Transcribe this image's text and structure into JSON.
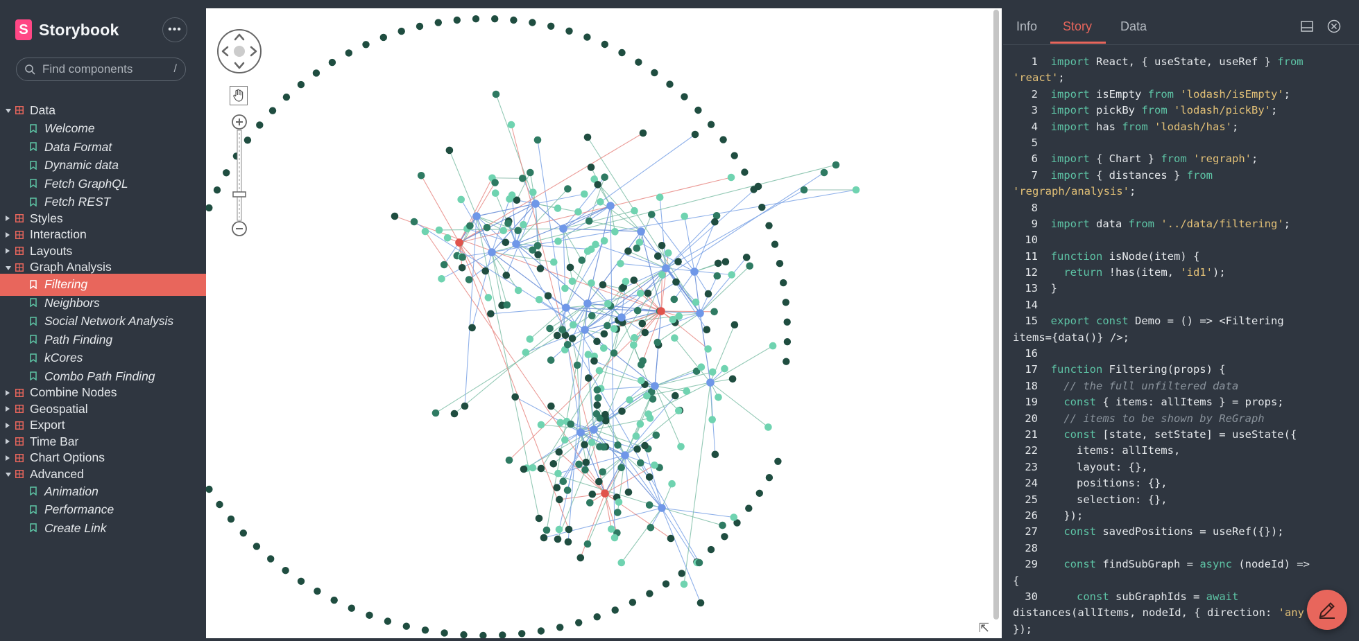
{
  "sidebar": {
    "brand_name": "Storybook",
    "menu_label": "•••",
    "search_placeholder": "Find components",
    "search_shortcut": "/",
    "tree": [
      {
        "type": "group",
        "label": "Data",
        "open": true
      },
      {
        "type": "story",
        "label": "Welcome"
      },
      {
        "type": "story",
        "label": "Data Format"
      },
      {
        "type": "story",
        "label": "Dynamic data"
      },
      {
        "type": "story",
        "label": "Fetch GraphQL"
      },
      {
        "type": "story",
        "label": "Fetch REST"
      },
      {
        "type": "group",
        "label": "Styles",
        "open": false
      },
      {
        "type": "group",
        "label": "Interaction",
        "open": false
      },
      {
        "type": "group",
        "label": "Layouts",
        "open": false
      },
      {
        "type": "group",
        "label": "Graph Analysis",
        "open": true
      },
      {
        "type": "story",
        "label": "Filtering",
        "active": true
      },
      {
        "type": "story",
        "label": "Neighbors"
      },
      {
        "type": "story",
        "label": "Social Network Analysis"
      },
      {
        "type": "story",
        "label": "Path Finding"
      },
      {
        "type": "story",
        "label": "kCores"
      },
      {
        "type": "story",
        "label": "Combo Path Finding"
      },
      {
        "type": "group",
        "label": "Combine Nodes",
        "open": false
      },
      {
        "type": "group",
        "label": "Geospatial",
        "open": false
      },
      {
        "type": "group",
        "label": "Export",
        "open": false
      },
      {
        "type": "group",
        "label": "Time Bar",
        "open": false
      },
      {
        "type": "group",
        "label": "Chart Options",
        "open": false
      },
      {
        "type": "group",
        "label": "Advanced",
        "open": true
      },
      {
        "type": "story",
        "label": "Animation"
      },
      {
        "type": "story",
        "label": "Performance"
      },
      {
        "type": "story",
        "label": "Create Link"
      }
    ]
  },
  "panel": {
    "tabs": [
      {
        "label": "Info",
        "active": false
      },
      {
        "label": "Story",
        "active": true
      },
      {
        "label": "Data",
        "active": false
      }
    ],
    "code_lines": [
      {
        "n": "1",
        "t": "import React, { useState, useRef } from"
      },
      {
        "n": "",
        "t": "'react';"
      },
      {
        "n": "2",
        "t": "import isEmpty from 'lodash/isEmpty';"
      },
      {
        "n": "3",
        "t": "import pickBy from 'lodash/pickBy';"
      },
      {
        "n": "4",
        "t": "import has from 'lodash/has';"
      },
      {
        "n": "5",
        "t": ""
      },
      {
        "n": "6",
        "t": "import { Chart } from 'regraph';"
      },
      {
        "n": "7",
        "t": "import { distances } from"
      },
      {
        "n": "",
        "t": "'regraph/analysis';"
      },
      {
        "n": "8",
        "t": ""
      },
      {
        "n": "9",
        "t": "import data from '../data/filtering';"
      },
      {
        "n": "10",
        "t": ""
      },
      {
        "n": "11",
        "t": "function isNode(item) {"
      },
      {
        "n": "12",
        "t": "  return !has(item, 'id1');"
      },
      {
        "n": "13",
        "t": "}"
      },
      {
        "n": "14",
        "t": ""
      },
      {
        "n": "15",
        "t": "export const Demo = () => <Filtering"
      },
      {
        "n": "",
        "t": "items={data()} />;"
      },
      {
        "n": "16",
        "t": ""
      },
      {
        "n": "17",
        "t": "function Filtering(props) {"
      },
      {
        "n": "18",
        "t": "  // the full unfiltered data"
      },
      {
        "n": "19",
        "t": "  const { items: allItems } = props;"
      },
      {
        "n": "20",
        "t": "  // items to be shown by ReGraph"
      },
      {
        "n": "21",
        "t": "  const [state, setState] = useState({"
      },
      {
        "n": "22",
        "t": "    items: allItems,"
      },
      {
        "n": "23",
        "t": "    layout: {},"
      },
      {
        "n": "24",
        "t": "    positions: {},"
      },
      {
        "n": "25",
        "t": "    selection: {},"
      },
      {
        "n": "26",
        "t": "  });"
      },
      {
        "n": "27",
        "t": "  const savedPositions = useRef({});"
      },
      {
        "n": "28",
        "t": ""
      },
      {
        "n": "29",
        "t": "  const findSubGraph = async (nodeId) =>"
      },
      {
        "n": "",
        "t": "{"
      },
      {
        "n": "30",
        "t": "    const subGraphIds = await"
      },
      {
        "n": "",
        "t": "distances(allItems, nodeId, { direction: 'any' }"
      },
      {
        "n": "",
        "t": "});"
      }
    ]
  },
  "colors": {
    "accent": "#e8665c",
    "node_dark": "#1f4d40",
    "node_mid": "#2e7a62",
    "node_light": "#6fd3b0",
    "node_blue": "#6f97e8",
    "node_red": "#e0534c"
  }
}
